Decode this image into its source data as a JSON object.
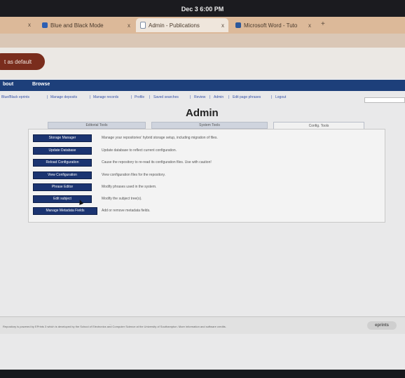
{
  "os_bar": {
    "clock": "Dec 3  6:00 PM"
  },
  "tabs": [
    {
      "label": "Blue and Black Mode",
      "close": "x"
    },
    {
      "label": "Admin - Publications",
      "close": "x"
    },
    {
      "label": "Microsoft Word - Tuto",
      "close": "x"
    }
  ],
  "lone_close": "x",
  "new_tab": "+",
  "default_button": {
    "label": "t as default"
  },
  "nav": {
    "items": [
      "bout",
      "Browse"
    ]
  },
  "links": {
    "items": [
      "Blue/Black eprints",
      "Manage deposits",
      "Manage records",
      "Profile",
      "Saved searches",
      "Review",
      "Admin",
      "Edit page phrases",
      "Logout"
    ],
    "separators": "|"
  },
  "page_title": "Admin",
  "panel_tabs": [
    "Editorial Tools",
    "System Tools",
    "Config. Tools"
  ],
  "actions": [
    {
      "button": "Storage Manager",
      "description": "Manage your repositories' hybrid storage setup, including migration of files."
    },
    {
      "button": "Update Database",
      "description": "Update database to reflect current configuration."
    },
    {
      "button": "Reload Configuration",
      "description": "Cause the repository to re-read its configuration files. Use with caution!"
    },
    {
      "button": "View Configuration",
      "description": "View configuration files for the repository."
    },
    {
      "button": "Phrase Editor",
      "description": "Modify phrases used in the system."
    },
    {
      "button": "Edit subject",
      "description": "Modify the subject tree(s)."
    },
    {
      "button": "Manage Metadata Fields",
      "description": "Add or remove metadata fields."
    }
  ],
  "footer": {
    "text": "Repository is powered by EPrints 3 which is developed by the School of Electronics and Computer Science at the University of Southampton. More information and software credits.",
    "tiny": "...",
    "logo": "eprints"
  },
  "colors": {
    "nav_blue": "#1d3f7a",
    "button_navy": "#1b3471",
    "default_button": "#7a2d1d",
    "tabstrip": "#dcb999"
  },
  "icons": {
    "tab1": "window-favicon-icon",
    "tab2": "document-favicon-icon",
    "tab3": "word-favicon-icon"
  }
}
